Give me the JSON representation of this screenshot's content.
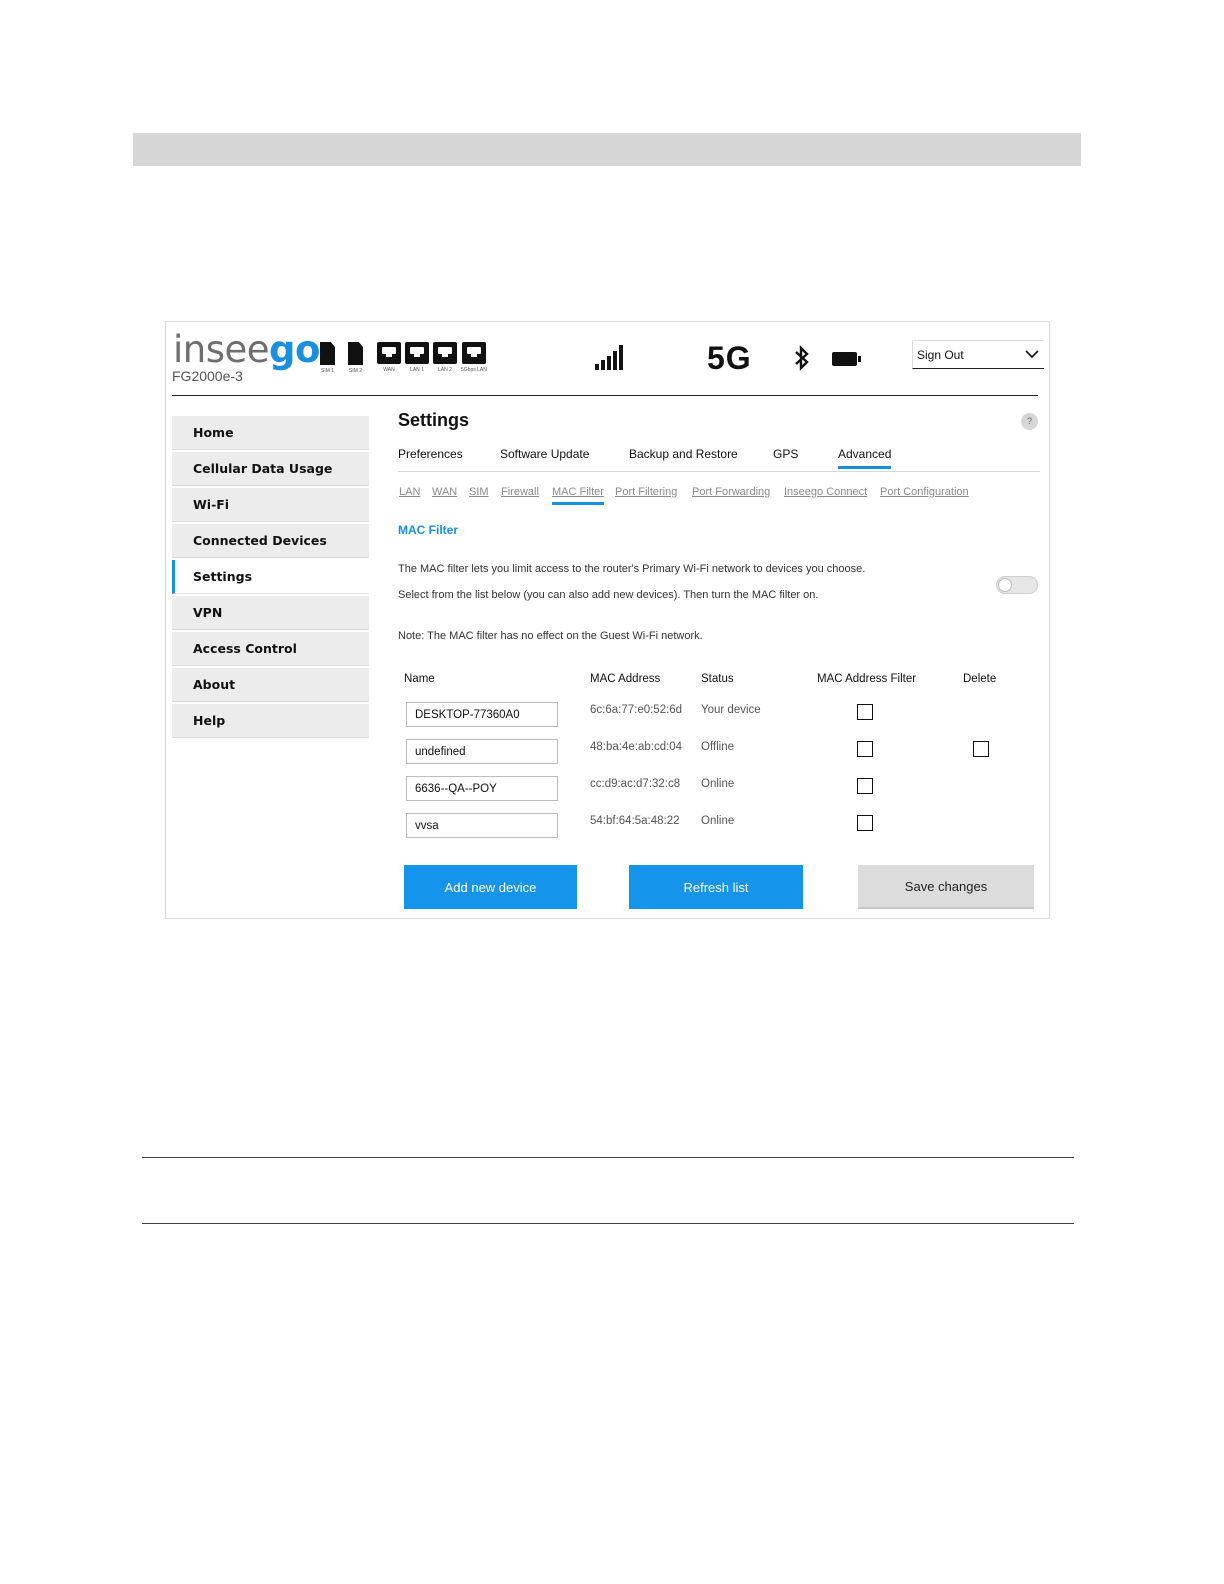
{
  "header": {
    "brand_ins": "insee",
    "brand_go": "go",
    "model": "FG2000e-3",
    "hw_indicators": [
      {
        "label": "SIM 1",
        "icon": "sim-icon"
      },
      {
        "label": "SIM 2",
        "icon": "sim-icon"
      },
      {
        "label": "WAN",
        "icon": "ethernet-port-icon"
      },
      {
        "label": "LAN 1",
        "icon": "ethernet-port-icon"
      },
      {
        "label": "LAN 2",
        "icon": "ethernet-port-icon"
      },
      {
        "label": "5Gbps LAN",
        "icon": "ethernet-port-icon"
      }
    ],
    "network_type": "5G",
    "sign_out": "Sign Out"
  },
  "sidebar": {
    "items": [
      {
        "label": "Home",
        "active": false
      },
      {
        "label": "Cellular Data Usage",
        "active": false
      },
      {
        "label": "Wi-Fi",
        "active": false
      },
      {
        "label": "Connected Devices",
        "active": false
      },
      {
        "label": "Settings",
        "active": true
      },
      {
        "label": "VPN",
        "active": false
      },
      {
        "label": "Access Control",
        "active": false
      },
      {
        "label": "About",
        "active": false
      },
      {
        "label": "Help",
        "active": false
      }
    ]
  },
  "main": {
    "title": "Settings",
    "help": "?",
    "tabs": [
      {
        "label": "Preferences",
        "active": false
      },
      {
        "label": "Software Update",
        "active": false
      },
      {
        "label": "Backup and Restore",
        "active": false
      },
      {
        "label": "GPS",
        "active": false
      },
      {
        "label": "Advanced",
        "active": true
      }
    ],
    "subtabs": [
      {
        "label": "LAN",
        "active": false
      },
      {
        "label": "WAN",
        "active": false
      },
      {
        "label": "SIM",
        "active": false
      },
      {
        "label": "Firewall",
        "active": false
      },
      {
        "label": "MAC Filter",
        "active": true
      },
      {
        "label": "Port Filtering",
        "active": false
      },
      {
        "label": "Port Forwarding",
        "active": false
      },
      {
        "label": "Inseego Connect",
        "active": false
      },
      {
        "label": "Port Configuration",
        "active": false
      }
    ],
    "section_title": "MAC Filter",
    "desc_1": "The MAC filter lets you limit access to the router's Primary Wi-Fi network to devices you choose.",
    "desc_2": "Select from the list below (you can also add new devices). Then turn the MAC filter on.",
    "note": "Note: The MAC filter has no effect on the Guest Wi-Fi network.",
    "mac_filter_enabled": false,
    "table": {
      "headers": {
        "name": "Name",
        "mac": "MAC Address",
        "status": "Status",
        "filter": "MAC Address Filter",
        "delete": "Delete"
      },
      "rows": [
        {
          "name": "DESKTOP-77360A0",
          "mac": "6c:6a:77:e0:52:6d",
          "status": "Your device",
          "filter": false,
          "deletable": false
        },
        {
          "name": "undefined",
          "mac": "48:ba:4e:ab:cd:04",
          "status": "Offline",
          "filter": false,
          "deletable": true
        },
        {
          "name": "6636--QA--POY",
          "mac": "cc:d9:ac:d7:32:c8",
          "status": "Online",
          "filter": false,
          "deletable": false
        },
        {
          "name": "vvsa",
          "mac": "54:bf:64:5a:48:22",
          "status": "Online",
          "filter": false,
          "deletable": false
        }
      ]
    },
    "buttons": {
      "add": "Add new device",
      "refresh": "Refresh list",
      "save": "Save changes"
    }
  },
  "colors": {
    "accent": "#1a8fe0",
    "button_blue": "#1594ec",
    "button_gray": "#dcdcdc"
  }
}
